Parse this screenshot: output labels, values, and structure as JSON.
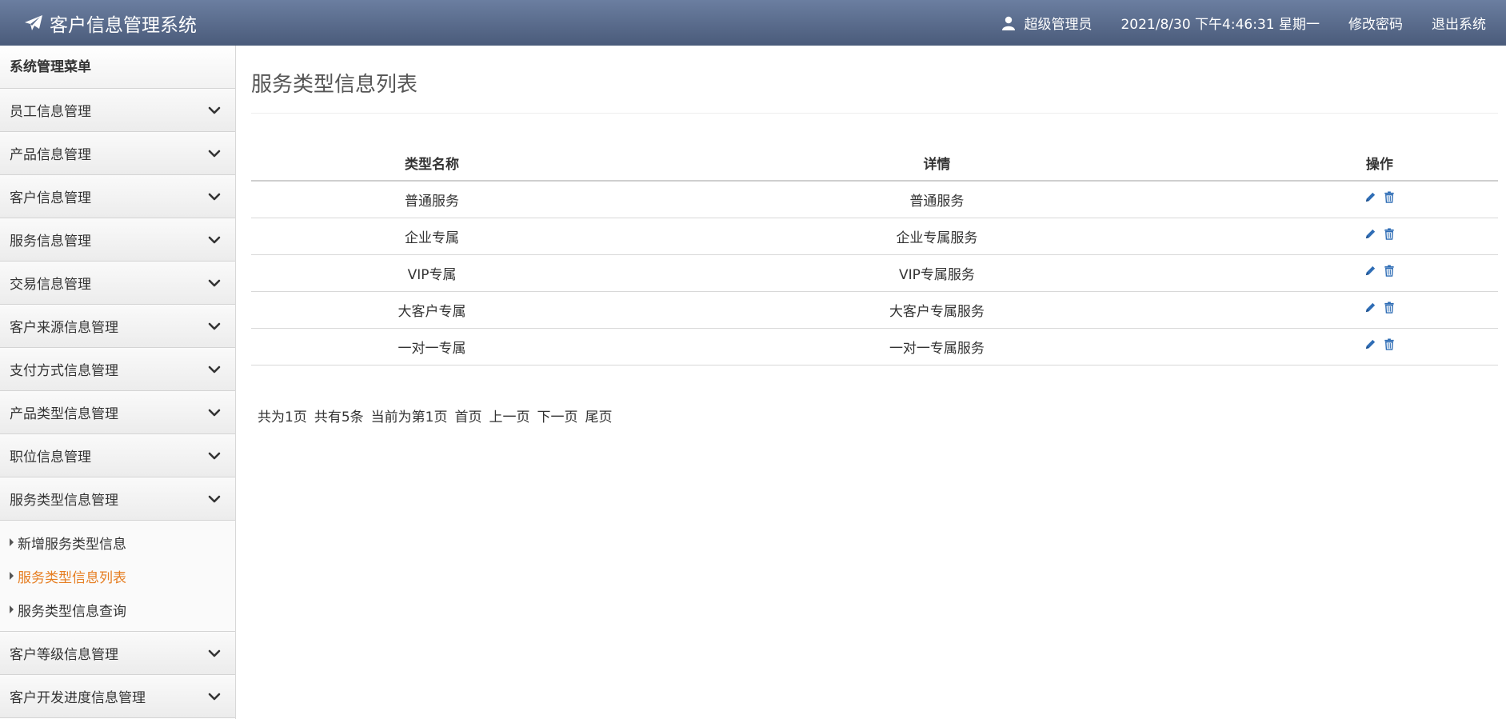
{
  "header": {
    "title": "客户信息管理系统",
    "user": "超级管理员",
    "datetime": "2021/8/30 下午4:46:31 星期一",
    "change_password": "修改密码",
    "logout": "退出系统"
  },
  "sidebar": {
    "title": "系统管理菜单",
    "groups": [
      {
        "label": "员工信息管理"
      },
      {
        "label": "产品信息管理"
      },
      {
        "label": "客户信息管理"
      },
      {
        "label": "服务信息管理"
      },
      {
        "label": "交易信息管理"
      },
      {
        "label": "客户来源信息管理"
      },
      {
        "label": "支付方式信息管理"
      },
      {
        "label": "产品类型信息管理"
      },
      {
        "label": "职位信息管理"
      },
      {
        "label": "服务类型信息管理"
      },
      {
        "label": "客户等级信息管理"
      },
      {
        "label": "客户开发进度信息管理"
      }
    ],
    "submenu": [
      {
        "label": "新增服务类型信息"
      },
      {
        "label": "服务类型信息列表"
      },
      {
        "label": "服务类型信息查询"
      }
    ],
    "active_color": "#e67e22"
  },
  "main": {
    "title": "服务类型信息列表",
    "columns": [
      "类型名称",
      "详情",
      "操作"
    ],
    "rows": [
      {
        "name": "普通服务",
        "detail": "普通服务"
      },
      {
        "name": "企业专属",
        "detail": "企业专属服务"
      },
      {
        "name": "VIP专属",
        "detail": "VIP专属服务"
      },
      {
        "name": "大客户专属",
        "detail": "大客户专属服务"
      },
      {
        "name": "一对一专属",
        "detail": "一对一专属服务"
      }
    ],
    "icons": {
      "edit": "pencil-icon",
      "delete": "trash-icon",
      "color": "#2f6db5"
    }
  },
  "pager": {
    "total_pages": "共为1页",
    "total_records": "共有5条",
    "current_page": "当前为第1页",
    "first": "首页",
    "prev": "上一页",
    "next": "下一页",
    "last": "尾页"
  }
}
